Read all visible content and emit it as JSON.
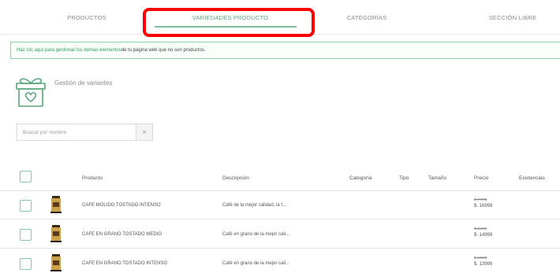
{
  "tabs": [
    {
      "label": "PRODUCTOS"
    },
    {
      "label": "VARIEDADES PRODUCTO"
    },
    {
      "label": "CATEGORÍAS"
    },
    {
      "label": "SECCIÓN LIBRE"
    }
  ],
  "info_banner": {
    "link_text": "Haz clic aquí para gestionar los demás elementos",
    "rest_text": " de tu página web que no son productos."
  },
  "section": {
    "title": "Gestión de variantes",
    "icon": "gift-icon"
  },
  "search": {
    "placeholder": "Buscar por nombre",
    "clear_symbol": "×"
  },
  "table": {
    "columns": [
      "Producto",
      "Descripción",
      "Categoría",
      "Tipo",
      "Tamaño",
      "Precio",
      "Existencias"
    ],
    "rows": [
      {
        "product": "CAFE MOLIDO TOSTADO INTENSO",
        "description": "Café de la mejor calidad, la t...",
        "price_old": "$ 17500",
        "price_new": "$. 16999"
      },
      {
        "product": "CAFE EN GRANO TOSTADO MEDIO",
        "description": "Café en grano de la mejor cali...",
        "price_old": "$ 15500",
        "price_new": "$. 14999"
      },
      {
        "product": "CAFE EN GRANO TOSTADO INTENSO",
        "description": "Café en grano de la mejor cali...",
        "price_old": "$ 14500",
        "price_new": "$. 13999"
      }
    ]
  },
  "colors": {
    "accent": "#5aa57a",
    "highlight": "#ff0000"
  }
}
